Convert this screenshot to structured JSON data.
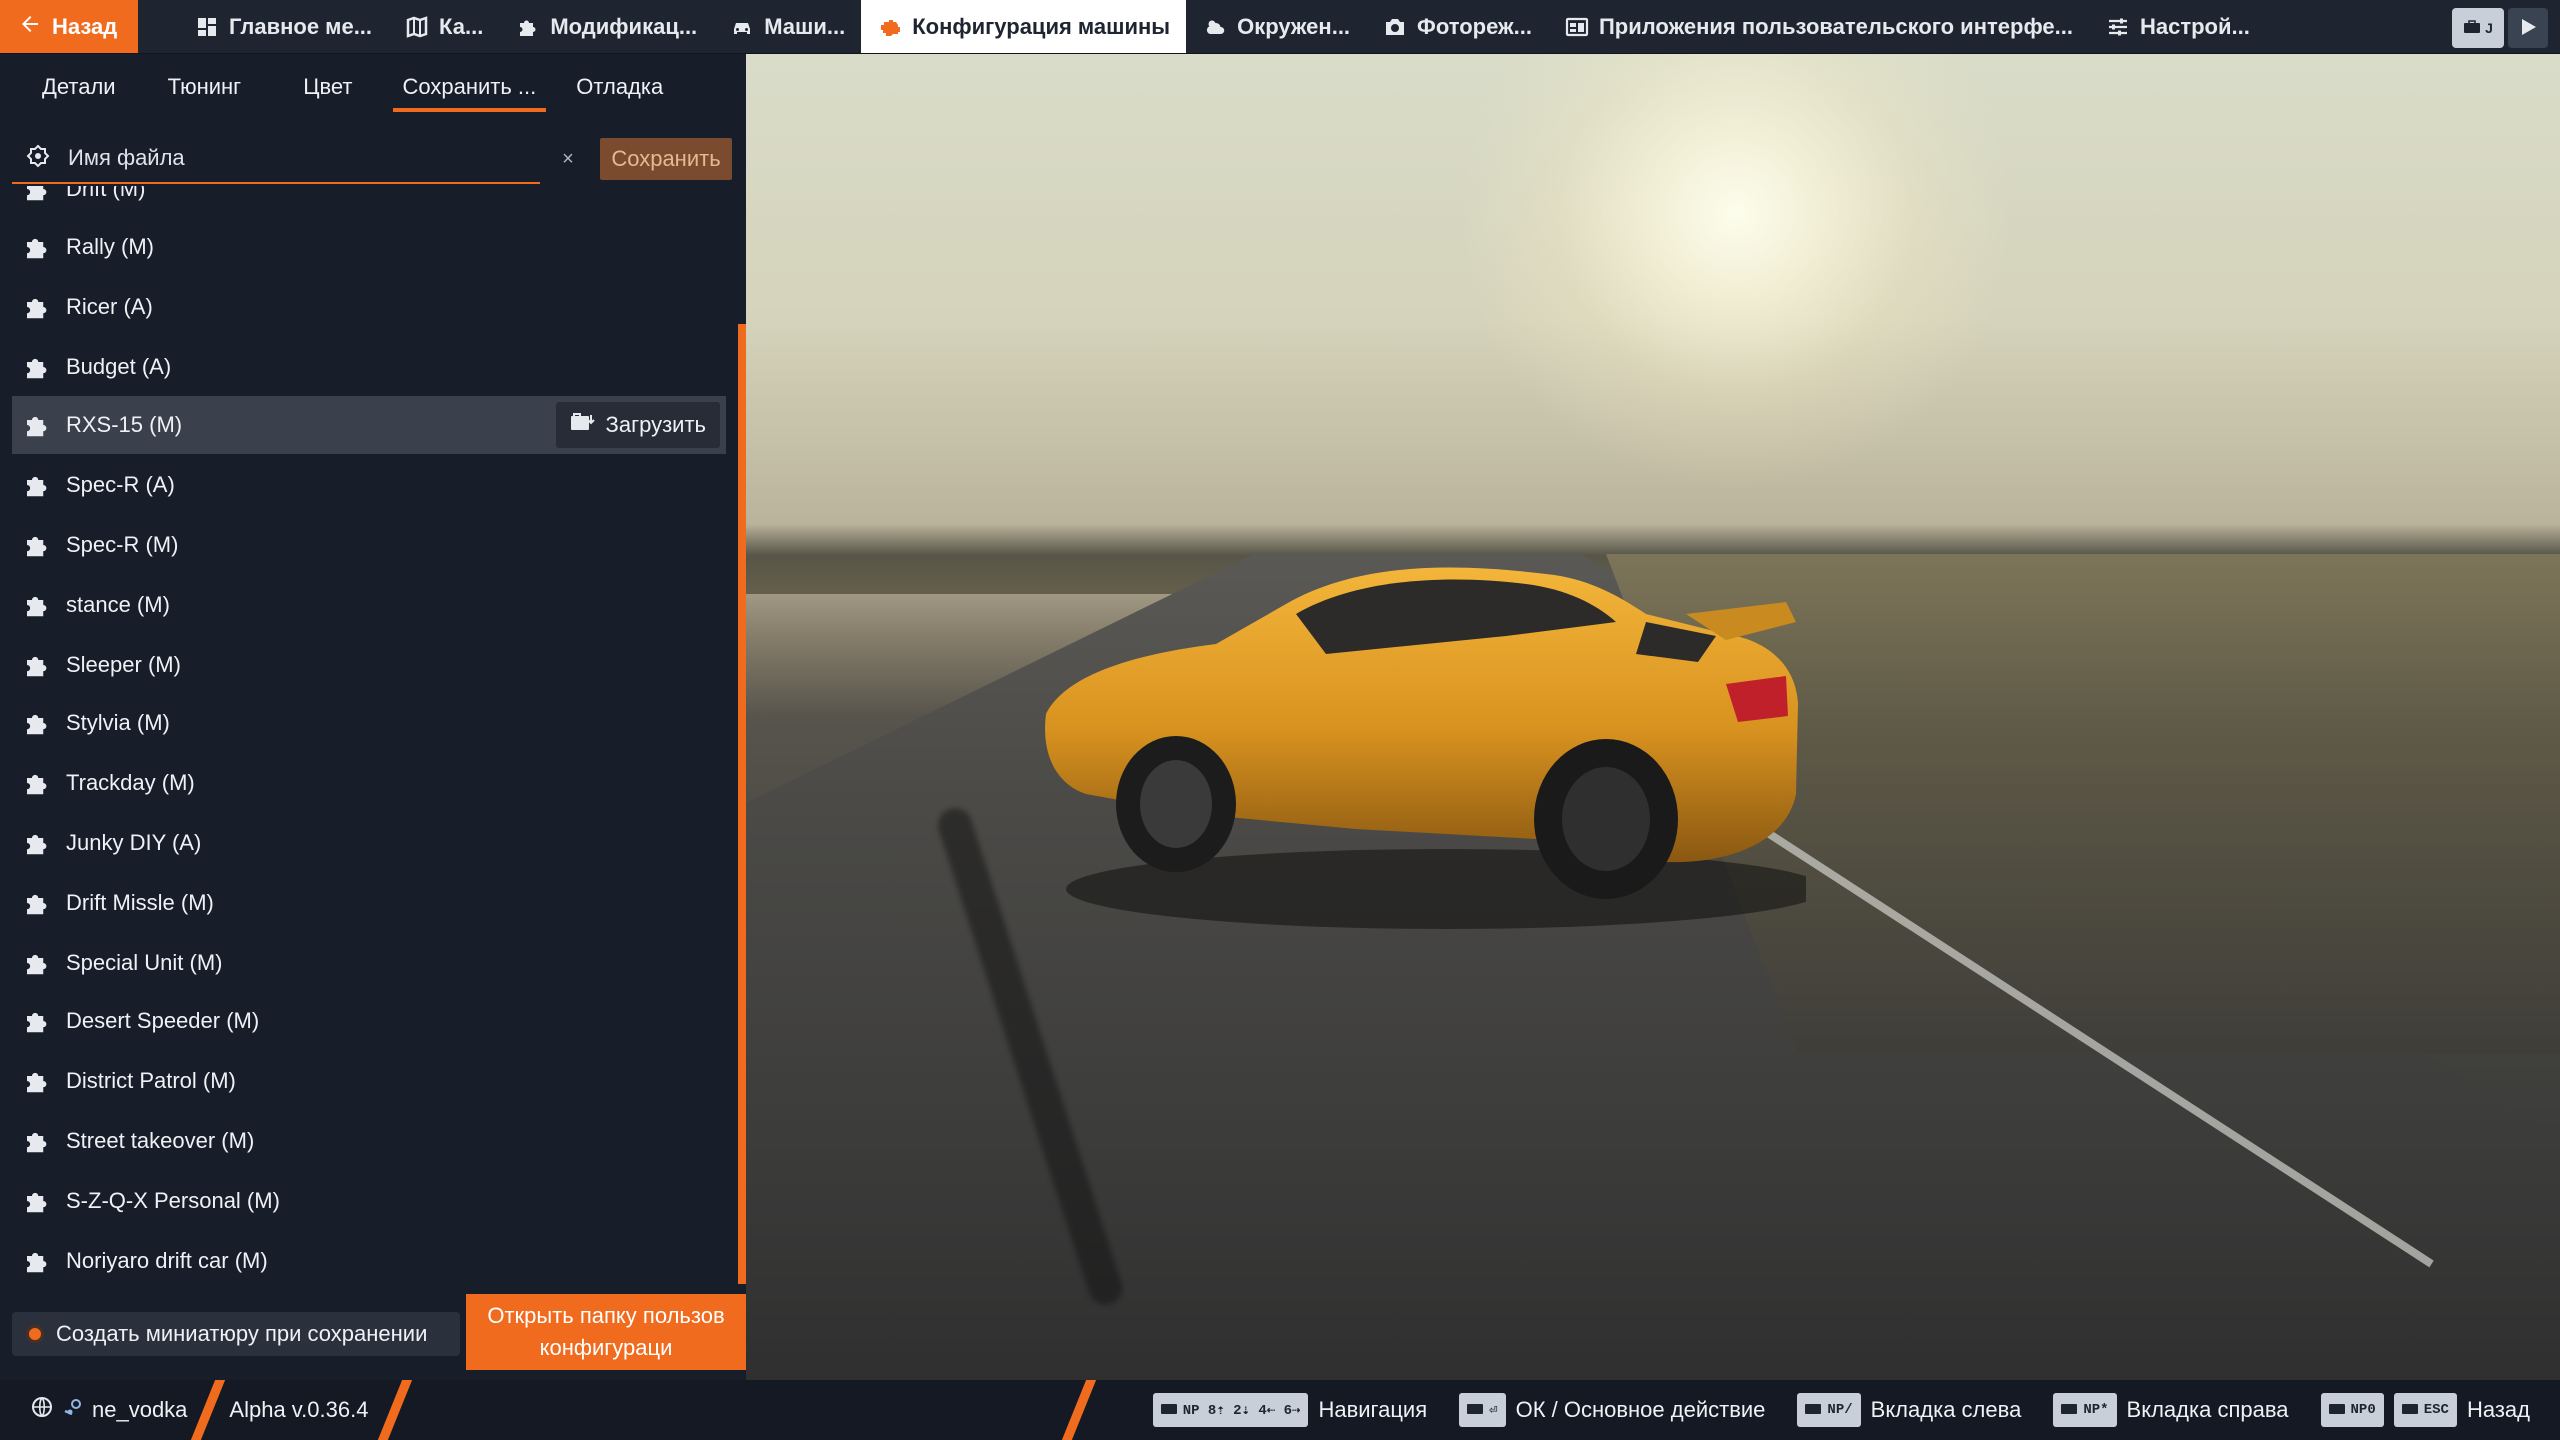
{
  "topbar": {
    "back_label": "Назад",
    "tabs": [
      {
        "label": "Главное ме...",
        "icon": "dashboard-icon"
      },
      {
        "label": "Ка...",
        "icon": "map-icon"
      },
      {
        "label": "Модификац...",
        "icon": "puzzle-icon"
      },
      {
        "label": "Маши...",
        "icon": "car-icon"
      },
      {
        "label": "Конфигурация машины",
        "icon": "engine-icon",
        "active": true
      },
      {
        "label": "Окружен...",
        "icon": "weather-icon"
      },
      {
        "label": "Фотореж...",
        "icon": "camera-icon"
      },
      {
        "label": "Приложения пользовательского интерфе...",
        "icon": "apps-icon"
      },
      {
        "label": "Настрой...",
        "icon": "sliders-icon"
      }
    ],
    "right_key_label": "J"
  },
  "subtabs": [
    {
      "label": "Детали"
    },
    {
      "label": "Тюнинг"
    },
    {
      "label": "Цвет"
    },
    {
      "label": "Сохранить ...",
      "active": true
    },
    {
      "label": "Отладка"
    }
  ],
  "search": {
    "placeholder": "Имя файла",
    "value": "",
    "clear_label": "×",
    "save_label": "Сохранить"
  },
  "configs": [
    {
      "label": "Drift (M)"
    },
    {
      "label": "Rally (M)"
    },
    {
      "label": "Ricer (A)"
    },
    {
      "label": "Budget (A)"
    },
    {
      "label": "RXS-15 (M)",
      "hovered": true
    },
    {
      "label": "Spec-R (A)"
    },
    {
      "label": "Spec-R (M)"
    },
    {
      "label": "stance (M)"
    },
    {
      "label": "Sleeper (M)"
    },
    {
      "label": "Stylvia (M)"
    },
    {
      "label": "Trackday (M)"
    },
    {
      "label": "Junky DIY (A)"
    },
    {
      "label": "Drift Missle (M)"
    },
    {
      "label": "Special Unit (M)"
    },
    {
      "label": "Desert Speeder (M)"
    },
    {
      "label": "District Patrol (M)"
    },
    {
      "label": "Street takeover (M)"
    },
    {
      "label": "S-Z-Q-X Personal (M)"
    },
    {
      "label": "Noriyaro drift car (M)"
    }
  ],
  "load_label": "Загрузить",
  "thumbnail_toggle_label": "Создать миниатюру при сохранении",
  "open_folder": {
    "line1": "Открыть папку пользов",
    "line2": "конфигураци"
  },
  "status": {
    "username": "ne_vodka",
    "version": "Alpha v.0.36.4",
    "hints": [
      {
        "keys": [
          "NP 8⇡ 2⇣ 4⇠ 6⇢"
        ],
        "label": "Навигация"
      },
      {
        "keys": [
          "⏎"
        ],
        "label": "ОК / Основное действие"
      },
      {
        "keys": [
          "NP/"
        ],
        "label": "Вкладка слева"
      },
      {
        "keys": [
          "NP*"
        ],
        "label": "Вкладка справа"
      },
      {
        "keys": [
          "NP0",
          "ESC"
        ],
        "label": "Назад"
      }
    ]
  },
  "colors": {
    "accent": "#f06b1e",
    "panel": "#171d29",
    "topbar": "#1f2530",
    "car_body": "#e8a528"
  }
}
